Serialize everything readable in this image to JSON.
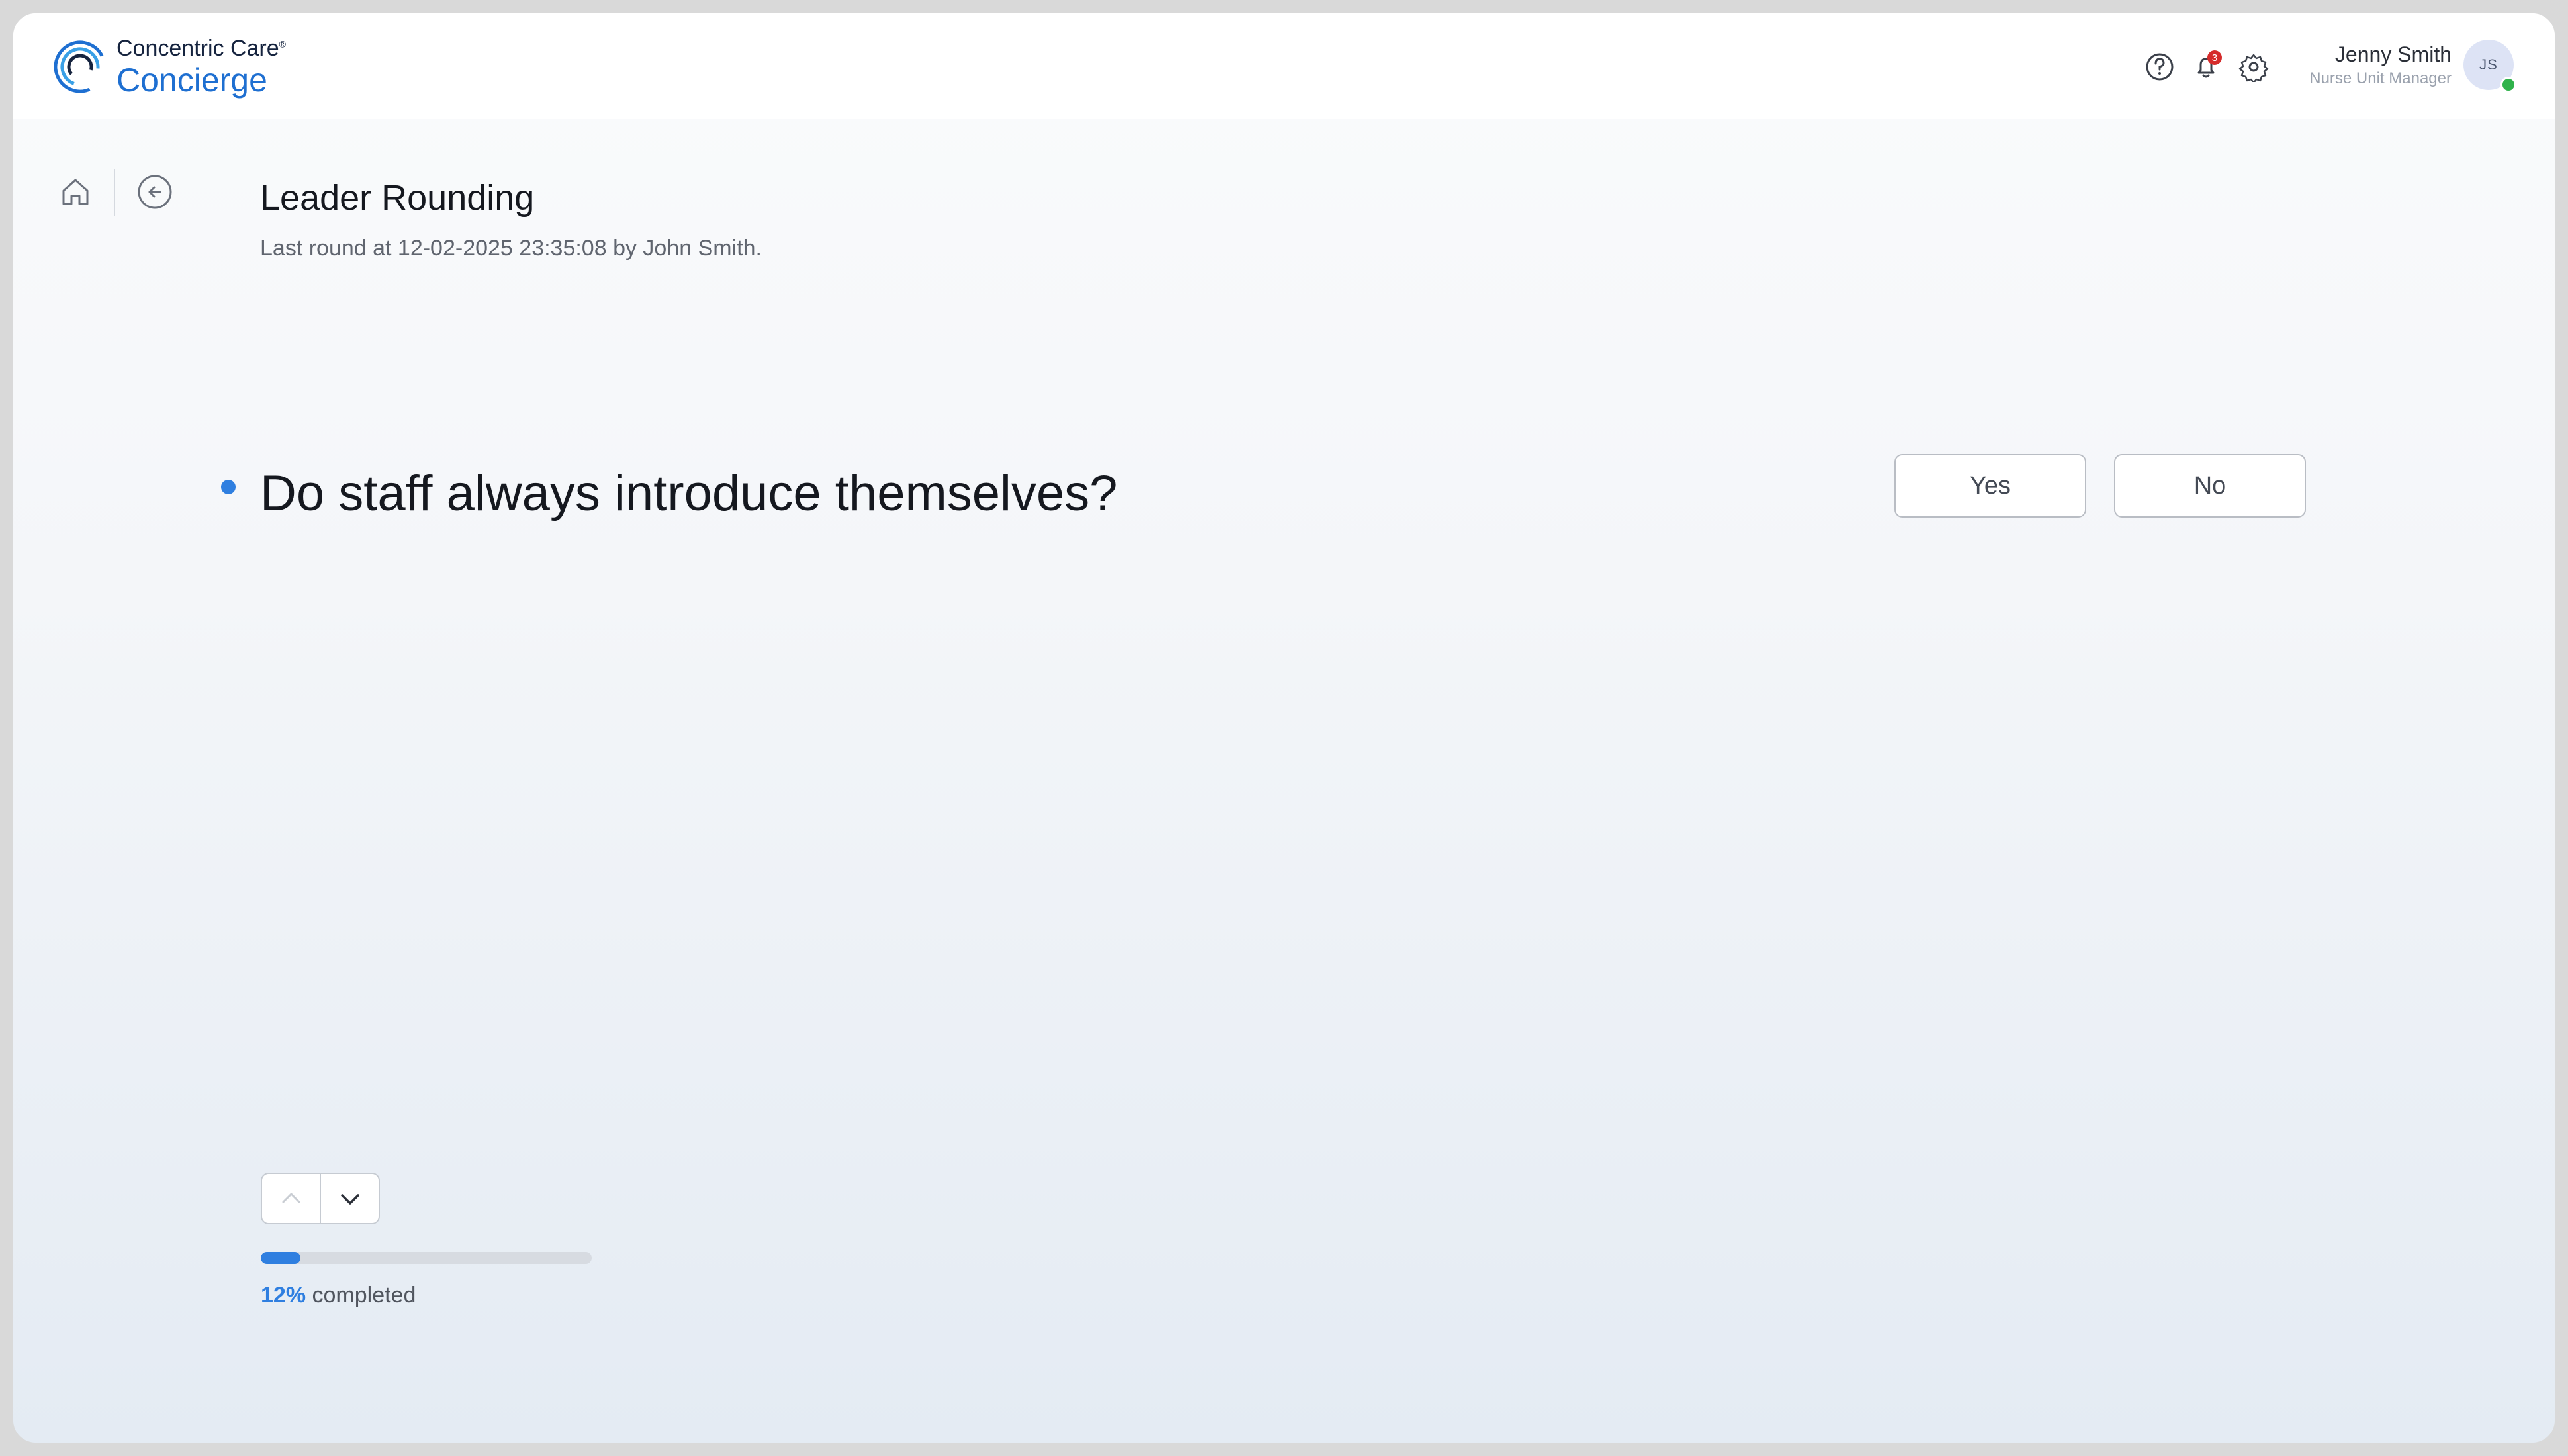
{
  "brand": {
    "name_top": "Concentric Care",
    "registered": "®",
    "name_bottom": "Concierge"
  },
  "header": {
    "notifications_count": "3",
    "user_name": "Jenny Smith",
    "user_role": "Nurse Unit Manager",
    "user_initials": "JS",
    "icons": [
      "help-icon",
      "bell-icon",
      "gear-icon"
    ]
  },
  "page": {
    "title": "Leader Rounding",
    "subtitle": "Last round at 12-02-2025 23:35:08 by John Smith."
  },
  "question": {
    "text": "Do staff always introduce themselves?",
    "options": [
      "Yes",
      "No"
    ]
  },
  "progress": {
    "percent_label": "12%",
    "suffix": "completed",
    "value": 0.12
  },
  "colors": {
    "accent": "#2f7fe0",
    "brand_blue": "#1e6fd1",
    "badge": "#d52b2b",
    "online": "#2fb24b"
  }
}
